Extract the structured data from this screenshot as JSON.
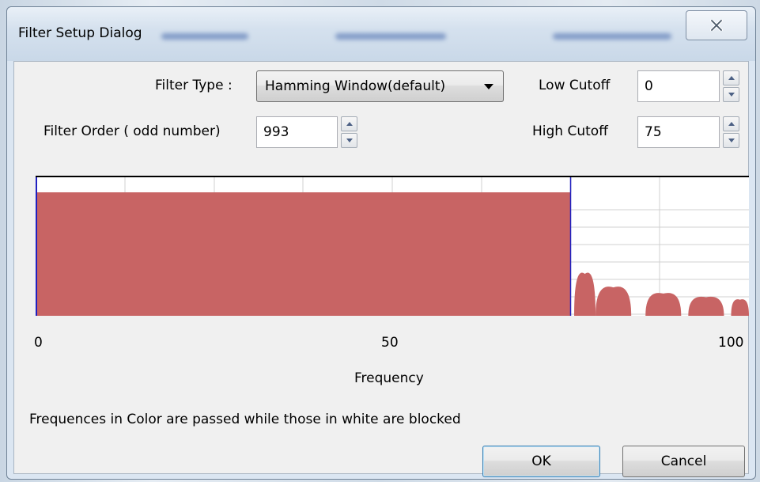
{
  "window": {
    "title": "Filter Setup Dialog"
  },
  "form": {
    "filter_type_label": "Filter Type :",
    "filter_type_value": "Hamming Window(default)",
    "filter_order_label": "Filter Order ( odd number)",
    "filter_order_value": "993",
    "low_cutoff_label": "Low Cutoff",
    "low_cutoff_value": "0",
    "high_cutoff_label": "High Cutoff",
    "high_cutoff_value": "75"
  },
  "chart_data": {
    "type": "area",
    "title": "",
    "xlabel": "Frequency",
    "ylabel": "",
    "xlim": [
      0,
      100
    ],
    "xticks": [
      "0",
      "50",
      "100"
    ],
    "pass_band": [
      0,
      75
    ],
    "low_cutoff": 0,
    "high_cutoff": 75,
    "stopband_lobes": [
      {
        "x_start": 75.5,
        "x_end": 78.5,
        "relative_height": 0.34
      },
      {
        "x_start": 78.5,
        "x_end": 83.5,
        "relative_height": 0.23
      },
      {
        "x_start": 85.5,
        "x_end": 90.5,
        "relative_height": 0.18
      },
      {
        "x_start": 91.5,
        "x_end": 96.5,
        "relative_height": 0.15
      },
      {
        "x_start": 97.5,
        "x_end": 100,
        "relative_height": 0.13
      }
    ],
    "grid": true,
    "fill_color": "#c86464",
    "cutoff_line_color": "#2020c0"
  },
  "status": {
    "note": "Frequences in Color are passed while those in white are blocked"
  },
  "buttons": {
    "ok": "OK",
    "cancel": "Cancel"
  }
}
